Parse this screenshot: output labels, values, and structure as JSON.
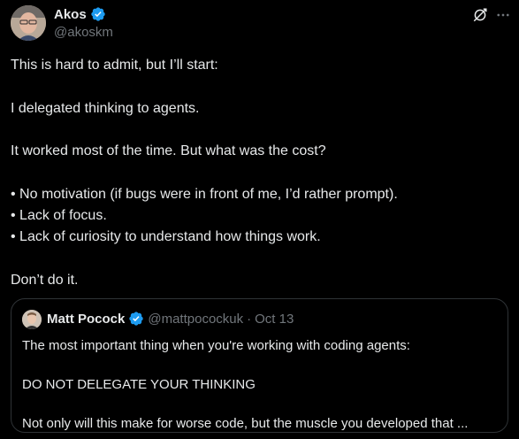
{
  "author": {
    "name": "Akos",
    "handle": "@akoskm",
    "verified": true
  },
  "tweet": {
    "lines": [
      "This is hard to admit, but I’ll start:",
      "I delegated thinking to agents.",
      "It worked most of the time. But what was the cost?",
      "• No motivation (if bugs were in front of me, I’d rather prompt).",
      "• Lack of focus.",
      "• Lack of curiosity to understand how things work.",
      "Don’t do it."
    ]
  },
  "quote": {
    "name": "Matt Pocock",
    "handle": "@mattpocockuk",
    "separator": "·",
    "date": "Oct 13",
    "verified": true,
    "lines": [
      "The most important thing when you're working with coding agents:",
      "DO NOT DELEGATE YOUR THINKING",
      "Not only will this make for worse code, but the muscle you developed that ..."
    ]
  },
  "icons": {
    "verified": "verified-badge-icon",
    "grok": "grok-icon",
    "more": "more-options-icon"
  },
  "colors": {
    "background": "#000000",
    "text": "#e7e9ea",
    "secondary_text": "#71767b",
    "verified_blue": "#1d9bf0",
    "border": "#2f3336"
  }
}
